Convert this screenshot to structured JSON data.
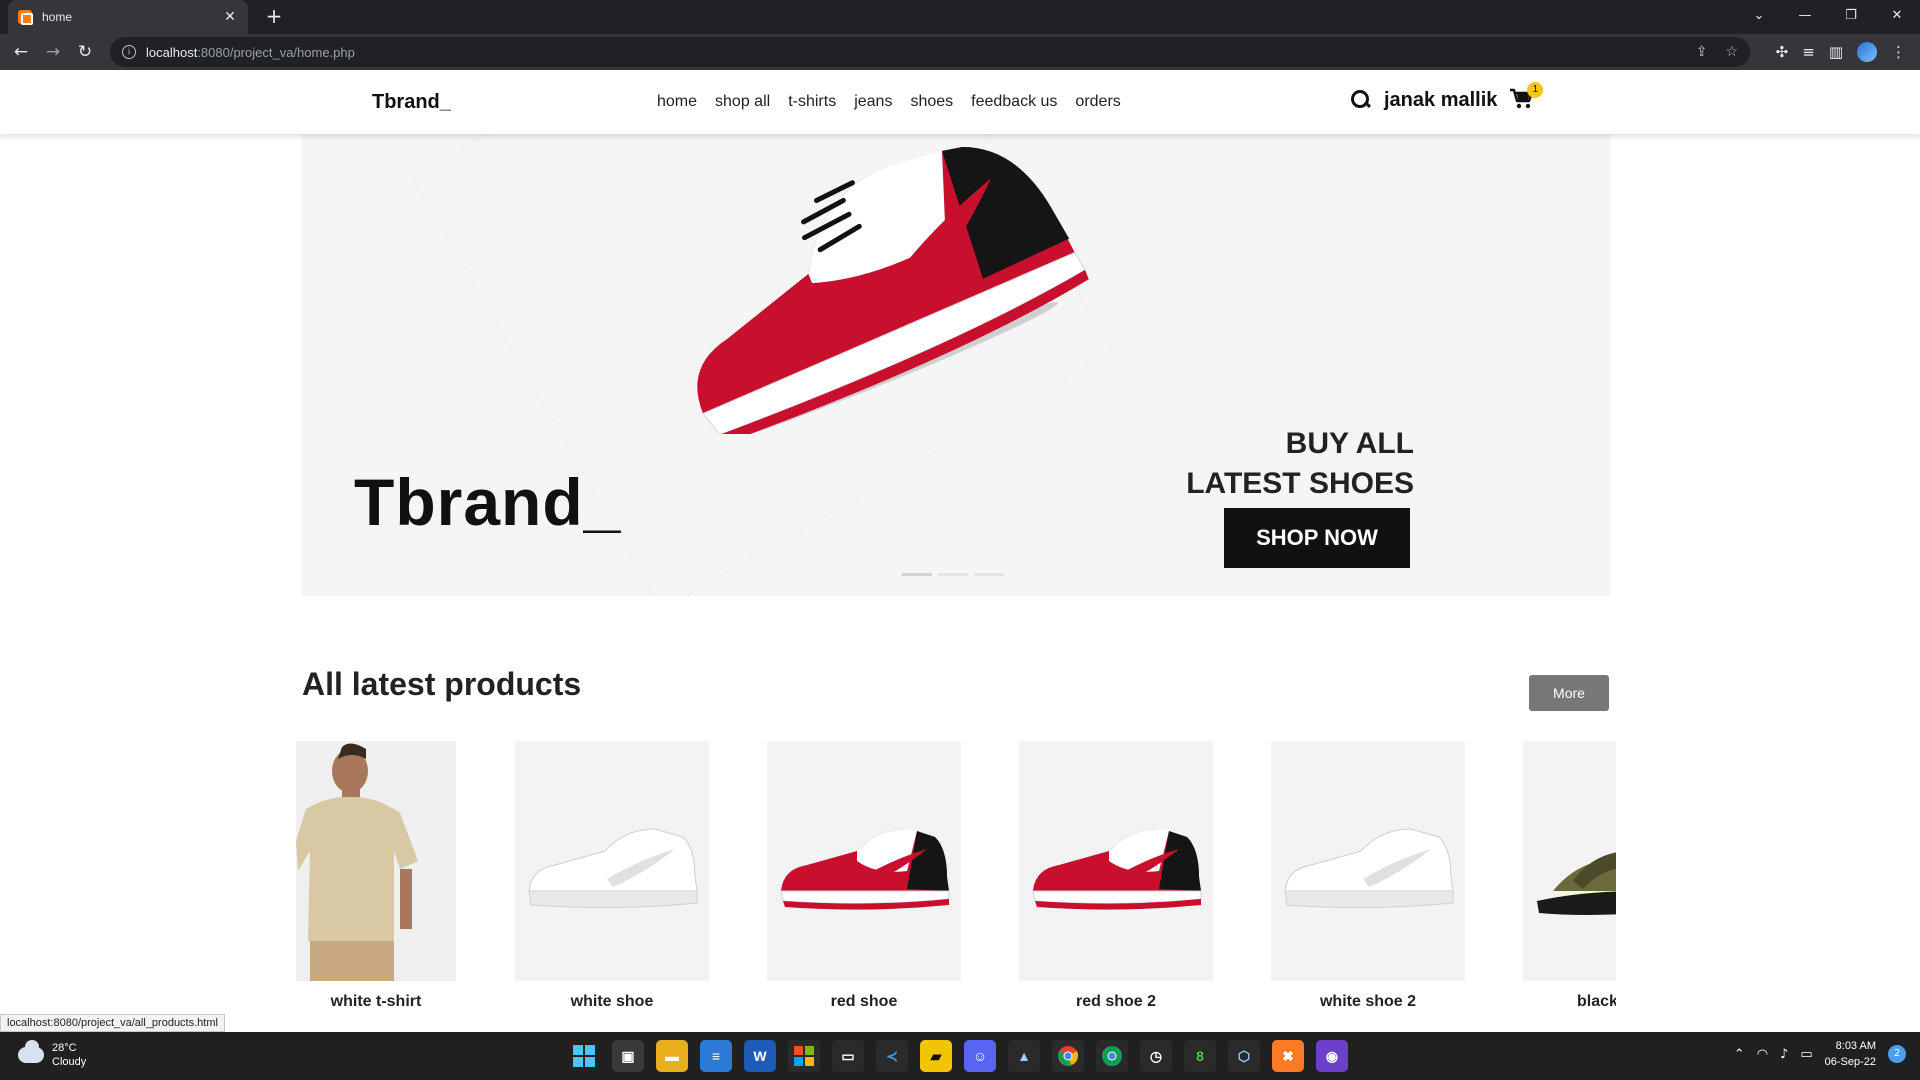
{
  "browser": {
    "tab_title": "home",
    "tab_close": "✕",
    "new_tab": "+",
    "url_host": "localhost",
    "url_path": ":8080/project_va/home.php",
    "status_url": "localhost:8080/project_va/all_products.html"
  },
  "header": {
    "logo": "Tbrand_",
    "nav": [
      "home",
      "shop all",
      "t-shirts",
      "jeans",
      "shoes",
      "feedback us",
      "orders"
    ],
    "user_name": "janak mallik",
    "cart_count": "1"
  },
  "hero": {
    "brand": "Tbrand_",
    "headline_line1": "BUY ALL",
    "headline_line2": "LATEST SHOES",
    "cta": "SHOP NOW",
    "slides": 3,
    "active_slide": 1
  },
  "products": {
    "title": "All latest products",
    "more_label": "More",
    "items": [
      {
        "name": "white t-shirt",
        "kind": "tshirt"
      },
      {
        "name": "white shoe",
        "kind": "white-shoe"
      },
      {
        "name": "red shoe",
        "kind": "red-shoe"
      },
      {
        "name": "red shoe 2",
        "kind": "red-shoe"
      },
      {
        "name": "white shoe 2",
        "kind": "white-shoe"
      },
      {
        "name": "black",
        "kind": "sandal"
      }
    ]
  },
  "taskbar": {
    "temperature": "28°C",
    "weather": "Cloudy",
    "time": "8:03 AM",
    "date": "06-Sep-22",
    "notifications": "2"
  },
  "colors": {
    "accent_red": "#c8102e",
    "badge_yellow": "#f5c518",
    "button_dark": "#111111",
    "more_gray": "#777777"
  }
}
